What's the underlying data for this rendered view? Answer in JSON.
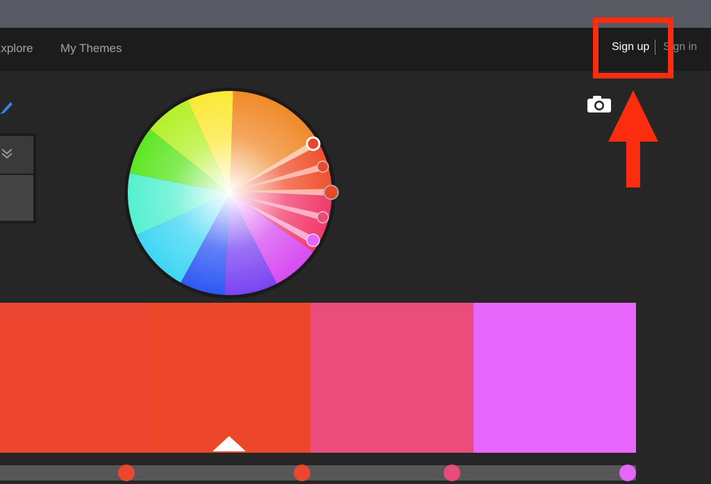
{
  "nav": {
    "explore": "Explore",
    "my_themes": "My Themes",
    "sign_up": "Sign up",
    "sign_in": "Sign in"
  },
  "icons": {
    "edit": "pencil-icon",
    "collapse": "double-chevron-down-icon",
    "camera": "camera-icon"
  },
  "theme": {
    "swatches": [
      "#ec4630",
      "#ec472b",
      "#ea4c7b",
      "#e766fb"
    ],
    "slider_colors": [
      "#ea4630",
      "#ea4630",
      "#e84c7d",
      "#e567f8"
    ]
  },
  "annotation": {
    "highlight_color": "#fc2c0f"
  }
}
